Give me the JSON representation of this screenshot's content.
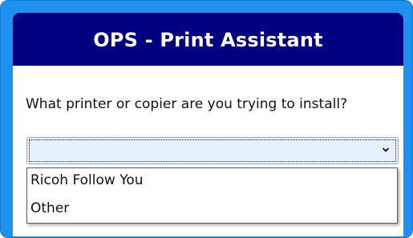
{
  "header": {
    "title": "OPS - Print Assistant"
  },
  "form": {
    "question": "What printer or copier are you trying to install?",
    "select_value": "",
    "options": [
      "Ricoh Follow You",
      "Other"
    ]
  },
  "colors": {
    "frame": "#1e90f0",
    "header_bg": "#000080",
    "header_text": "#ffffff",
    "select_bg": "#e6f0fb"
  },
  "icons": {
    "dropdown_arrow": "chevron-down-icon"
  }
}
